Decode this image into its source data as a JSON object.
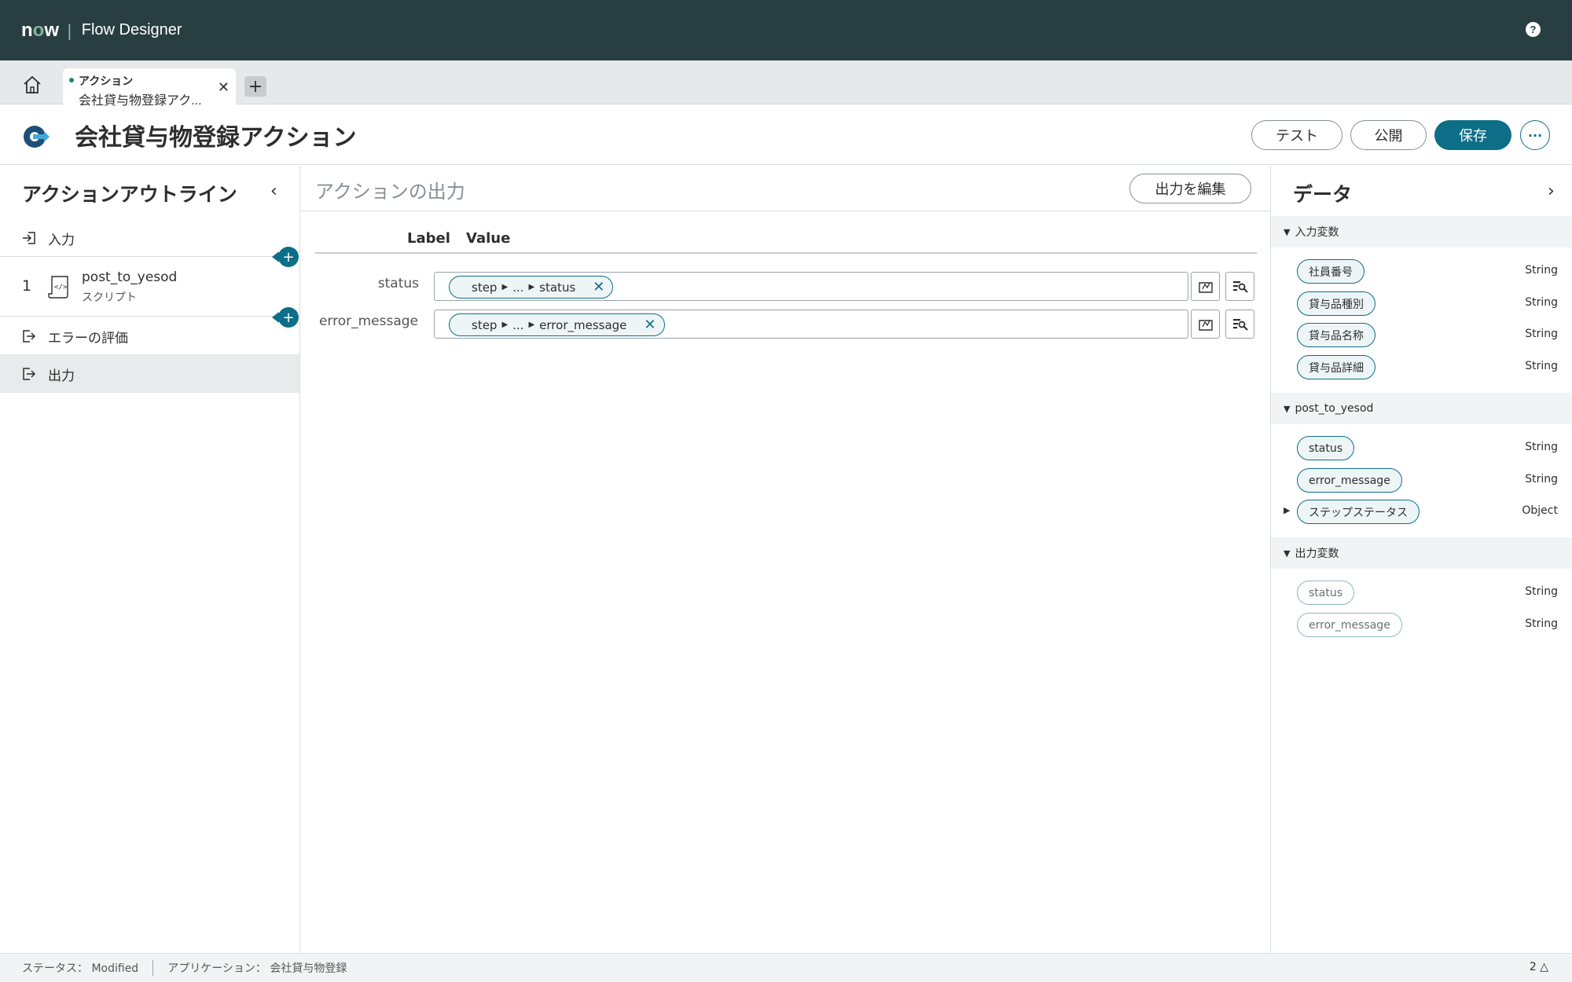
{
  "header": {
    "logo": "now",
    "app_title": "Flow Designer",
    "help_label": "?"
  },
  "tabs": {
    "active_tab": {
      "type": "アクション",
      "name": "会社貸与物登録アク..."
    },
    "add_label": "+"
  },
  "title_bar": {
    "title": "会社貸与物登録アクション",
    "buttons": {
      "test": "テスト",
      "publish": "公開",
      "save": "保存",
      "more": "···"
    }
  },
  "outline": {
    "title": "アクションアウトライン",
    "input_label": "入力",
    "step": {
      "number": "1",
      "name": "post_to_yesod",
      "type": "スクリプト"
    },
    "error_label": "エラーの評価",
    "output_label": "出力"
  },
  "main": {
    "title": "アクションの出力",
    "edit_button": "出力を編集",
    "columns": {
      "label": "Label",
      "value": "Value"
    },
    "rows": [
      {
        "label": "status",
        "pill": {
          "prefix": "step",
          "middle": "...",
          "field": "status"
        }
      },
      {
        "label": "error_message",
        "pill": {
          "prefix": "step",
          "middle": "...",
          "field": "error_message"
        }
      }
    ]
  },
  "data_panel": {
    "title": "データ",
    "sections": [
      {
        "header": "入力変数",
        "items": [
          {
            "name": "社員番号",
            "type": "String"
          },
          {
            "name": "貸与品種別",
            "type": "String"
          },
          {
            "name": "貸与品名称",
            "type": "String"
          },
          {
            "name": "貸与品詳細",
            "type": "String"
          }
        ]
      },
      {
        "header": "post_to_yesod",
        "items": [
          {
            "name": "status",
            "type": "String"
          },
          {
            "name": "error_message",
            "type": "String"
          },
          {
            "name": "ステップステータス",
            "type": "Object"
          }
        ]
      },
      {
        "header": "出力変数",
        "items": [
          {
            "name": "status",
            "type": "String"
          },
          {
            "name": "error_message",
            "type": "String"
          }
        ]
      }
    ]
  },
  "statusbar": {
    "status": "ステータス： Modified",
    "application": "アプリケーション： 会社貸与物登録",
    "notifications": "2"
  },
  "colors": {
    "topbar": "#293e40",
    "accent": "#0d6e87",
    "logo_o": "#81b5a1"
  },
  "icons": [
    "home-icon",
    "close-icon",
    "action-icon",
    "input-icon",
    "script-icon",
    "error-eval-icon",
    "output-icon",
    "data-pill-icon",
    "data-picker-icon",
    "help-icon",
    "bell-icon"
  ]
}
